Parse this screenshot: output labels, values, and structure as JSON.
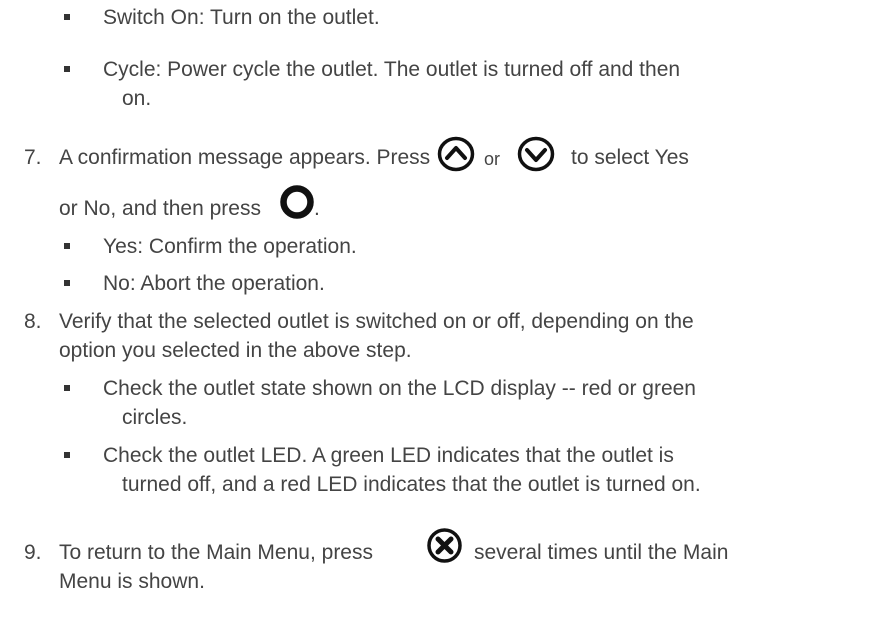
{
  "bullets_top": [
    {
      "text": "Switch On: Turn on the outlet."
    },
    {
      "text": "Cycle: Power cycle the outlet. The outlet is turned off and then",
      "cont": "on."
    }
  ],
  "step7": {
    "number": "7.",
    "text_a": "A confirmation message appears. Press",
    "text_or": "or",
    "text_b": "to select Yes",
    "text_c": "or No, and then press",
    "text_end": ".",
    "icons": [
      "up-button-icon",
      "down-button-icon",
      "ok-button-icon"
    ],
    "bullets": [
      {
        "text": "Yes: Confirm the operation."
      },
      {
        "text": "No: Abort the operation."
      }
    ]
  },
  "step8": {
    "number": "8.",
    "line1": "Verify that the selected outlet is switched on or off, depending on the",
    "line2": "option you selected in the above step.",
    "bullets": [
      {
        "text": "Check the outlet state shown on the LCD display -- red or green",
        "cont": "circles."
      },
      {
        "text": "Check the outlet LED. A green LED indicates that the outlet is",
        "cont": "turned off, and a red LED indicates that the outlet is turned on."
      }
    ]
  },
  "step9": {
    "number": "9.",
    "text_a": "To return to the Main Menu, press",
    "text_b": "several times until the Main",
    "line2": "Menu is shown.",
    "icons": [
      "escape-button-icon"
    ]
  }
}
